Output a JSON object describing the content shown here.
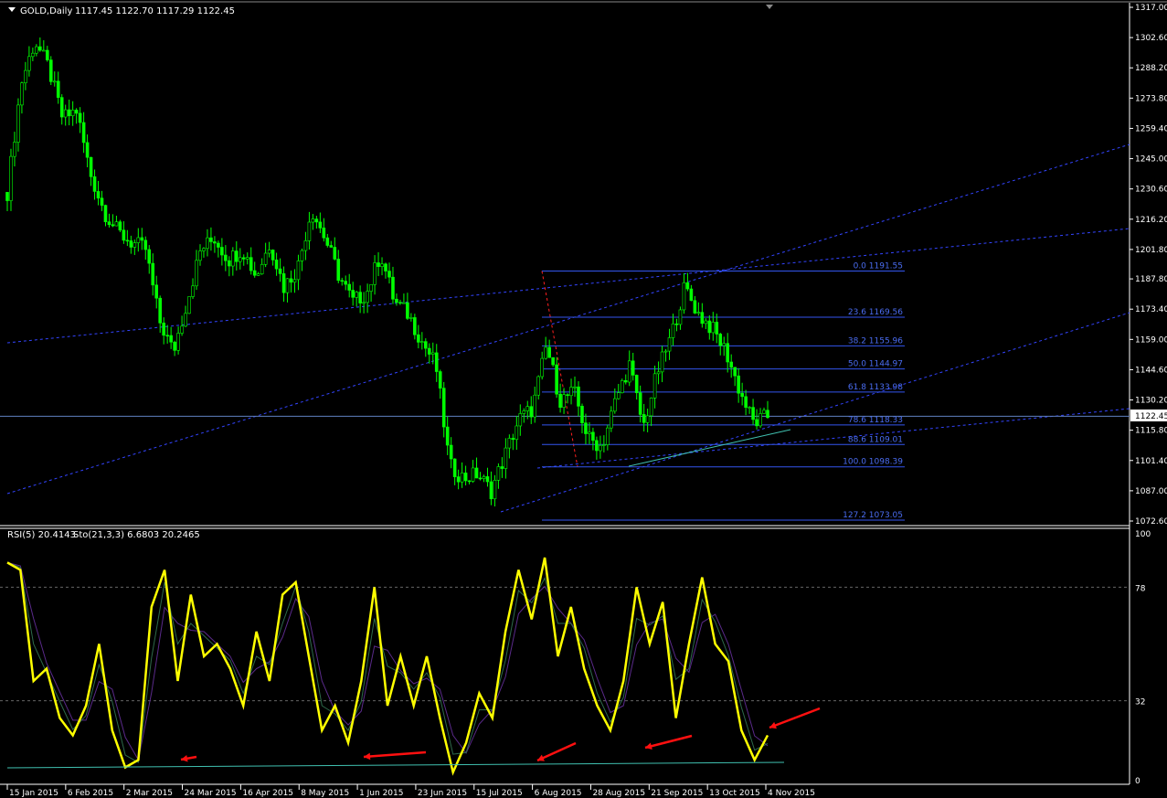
{
  "header": {
    "symbol_label": "GOLD,Daily",
    "ohlc": "1117.45 1122.70 1117.29 1122.45"
  },
  "indicator_header": {
    "rsi": "RSI(5) 20.4143",
    "sto": "Sto(21,3,3) 6.6803 20.2465"
  },
  "current_price": "1122.45",
  "colors": {
    "candle": "#00ff00",
    "rsi": "#ffff00",
    "fib": "#3355ee",
    "arrow": "#ff1010",
    "trend": "#3344ff",
    "support": "#40c0b0"
  },
  "chart_data": {
    "type": "line",
    "title": "GOLD,Daily",
    "ylim": [
      1072.6,
      1317.0
    ],
    "price_ticks": [
      "1317.00",
      "1302.60",
      "1288.20",
      "1273.80",
      "1259.40",
      "1245.00",
      "1230.60",
      "1216.20",
      "1201.80",
      "1187.80",
      "1173.40",
      "1159.00",
      "1144.60",
      "1130.20",
      "1115.80",
      "1101.40",
      "1087.00",
      "1072.60"
    ],
    "date_ticks": [
      "15 Jan 2015",
      "6 Feb 2015",
      "2 Mar 2015",
      "24 Mar 2015",
      "16 Apr 2015",
      "8 May 2015",
      "1 Jun 2015",
      "23 Jun 2015",
      "15 Jul 2015",
      "6 Aug 2015",
      "28 Aug 2015",
      "21 Sep 2015",
      "13 Oct 2015",
      "4 Nov 2015"
    ],
    "price_path": [
      1229,
      1281,
      1301,
      1288,
      1264,
      1268,
      1238,
      1220,
      1210,
      1205,
      1202,
      1168,
      1153,
      1177,
      1202,
      1207,
      1197,
      1202,
      1189,
      1205,
      1184,
      1193,
      1221,
      1207,
      1189,
      1177,
      1181,
      1200,
      1177,
      1171,
      1158,
      1147,
      1099,
      1093,
      1095,
      1087,
      1104,
      1121,
      1126,
      1156,
      1130,
      1134,
      1112,
      1108,
      1130,
      1147,
      1117,
      1143,
      1160,
      1184,
      1171,
      1164,
      1153,
      1134,
      1119,
      1122.45
    ],
    "fib_levels": [
      {
        "label": "0.0 1191.55",
        "price": 1191.55
      },
      {
        "label": "23.6 1169.56",
        "price": 1169.56
      },
      {
        "label": "38.2 1155.96",
        "price": 1155.96
      },
      {
        "label": "50.0  1144.97",
        "price": 1144.97
      },
      {
        "label": "61.8 1133.98",
        "price": 1133.98
      },
      {
        "label": "78.6 1118.33",
        "price": 1118.33
      },
      {
        "label": "88.6 1109.01",
        "price": 1109.01
      },
      {
        "label": "100.0 1098.39",
        "price": 1098.39
      },
      {
        "label": "127.2 1073.05",
        "price": 1073.05
      }
    ],
    "indicator": {
      "ylim": [
        0,
        100
      ],
      "ticks": [
        "100",
        "78",
        "32",
        "0"
      ],
      "levels": [
        78,
        32
      ],
      "rsi_path": [
        88,
        85,
        40,
        45,
        25,
        18,
        30,
        55,
        20,
        5,
        8,
        70,
        85,
        40,
        75,
        50,
        55,
        45,
        30,
        60,
        40,
        75,
        80,
        50,
        20,
        30,
        15,
        40,
        78,
        30,
        50,
        30,
        50,
        25,
        3,
        15,
        35,
        25,
        60,
        85,
        65,
        90,
        50,
        70,
        45,
        30,
        20,
        40,
        78,
        55,
        72,
        25,
        55,
        82,
        55,
        48,
        20,
        8,
        18
      ]
    }
  }
}
